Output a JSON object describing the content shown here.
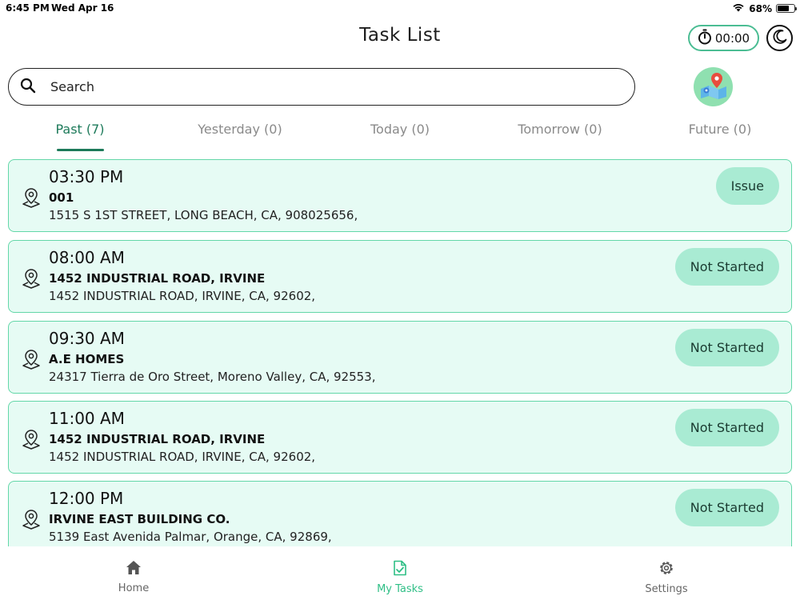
{
  "status_bar": {
    "time": "6:45 PM",
    "date": "Wed Apr 16",
    "battery": "68%",
    "battery_level": 0.68
  },
  "header": {
    "title": "Task List",
    "timer": "00:00",
    "timer_icon": "stopwatch-icon",
    "theme_icon": "moon-icon",
    "map_icon": "map-pin-icon"
  },
  "search": {
    "placeholder": "Search",
    "value": ""
  },
  "tabs": [
    {
      "label": "Past (7)",
      "active": true
    },
    {
      "label": "Yesterday (0)",
      "active": false
    },
    {
      "label": "Today (0)",
      "active": false
    },
    {
      "label": "Tomorrow (0)",
      "active": false
    },
    {
      "label": "Future (0)",
      "active": false
    }
  ],
  "tasks": [
    {
      "time": "03:30 PM",
      "name": "001",
      "address": "1515 S 1ST STREET, LONG BEACH, CA, 908025656,",
      "status": "Issue"
    },
    {
      "time": "08:00 AM",
      "name": "1452 INDUSTRIAL ROAD, IRVINE",
      "address": "1452 INDUSTRIAL ROAD, IRVINE, CA, 92602,",
      "status": "Not Started"
    },
    {
      "time": "09:30 AM",
      "name": "A.E HOMES",
      "address": "24317 Tierra de Oro Street, Moreno Valley, CA, 92553,",
      "status": "Not Started"
    },
    {
      "time": "11:00 AM",
      "name": "1452 INDUSTRIAL ROAD, IRVINE",
      "address": "1452 INDUSTRIAL ROAD, IRVINE, CA, 92602,",
      "status": "Not Started"
    },
    {
      "time": "12:00 PM",
      "name": "IRVINE EAST BUILDING CO.",
      "address": "5139 East Avenida Palmar, Orange, CA, 92869,",
      "status": "Not Started"
    }
  ],
  "bottom_nav": [
    {
      "label": "Home",
      "icon": "home-icon",
      "active": false
    },
    {
      "label": "My Tasks",
      "icon": "task-check-icon",
      "active": true
    },
    {
      "label": "Settings",
      "icon": "gear-icon",
      "active": false
    }
  ],
  "colors": {
    "accent": "#1d7a5a",
    "card_background": "#e6fbf4",
    "card_border": "#63d7a8",
    "status_pill": "#a9ebd3",
    "nav_active": "#2fbf86"
  }
}
